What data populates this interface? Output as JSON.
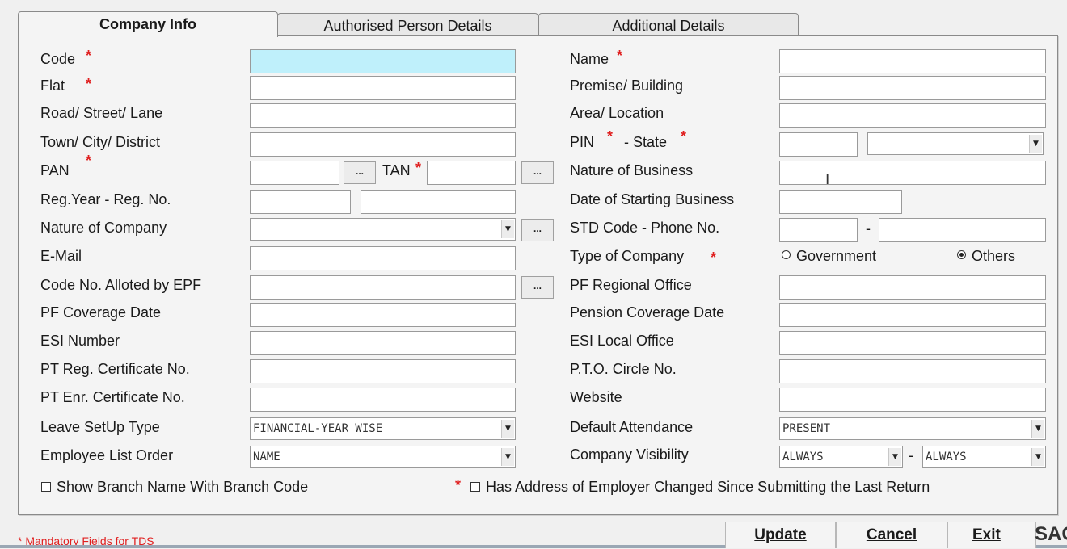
{
  "tabs": [
    {
      "label": "Company Info",
      "active": true
    },
    {
      "label": "Authorised Person Details",
      "active": false
    },
    {
      "label": "Additional Details",
      "active": false
    }
  ],
  "mandatory_mark": "*",
  "ellipsis": "...",
  "left": {
    "code": "Code",
    "flat": "Flat",
    "road": "Road/ Street/ Lane",
    "town": "Town/ City/ District",
    "pan": "PAN",
    "tan": "TAN",
    "reg": "Reg.Year - Reg. No.",
    "nature_company": "Nature of Company",
    "email": "E-Mail",
    "epf_code": "Code No. Alloted by EPF",
    "pf_coverage": "PF Coverage Date",
    "esi_number": "ESI Number",
    "pt_reg": "PT Reg. Certificate No.",
    "pt_enr": "PT Enr. Certificate No.",
    "leave_setup": "Leave SetUp Type",
    "leave_setup_value": "FINANCIAL-YEAR WISE",
    "employee_order": "Employee List Order",
    "employee_order_value": "NAME"
  },
  "right": {
    "name": "Name",
    "premise": "Premise/ Building",
    "area": "Area/ Location",
    "pin": "PIN",
    "state": "- State",
    "nature_business": "Nature of Business",
    "date_start": "Date of Starting Business",
    "std_phone": "STD Code - Phone No.",
    "phone_sep": "-",
    "type_company": "Type of Company",
    "radio_government": "Government",
    "radio_others": "Others",
    "selected_type": "Others",
    "pf_regional": "PF Regional Office",
    "pension_coverage": "Pension Coverage Date",
    "esi_local": "ESI Local Office",
    "pto_circle": "P.T.O. Circle No.",
    "website": "Website",
    "default_attendance": "Default Attendance",
    "default_attendance_value": "PRESENT",
    "visibility": "Company Visibility",
    "visibility_from": "ALWAYS",
    "visibility_sep": "-",
    "visibility_to": "ALWAYS"
  },
  "checkboxes": {
    "branch_name": "Show Branch Name With Branch Code",
    "address_changed": "Has Address of Employer Changed Since Submitting the Last Return"
  },
  "footer": {
    "note": "Mandatory Fields for TDS",
    "update": "Update",
    "cancel": "Cancel",
    "exit": "Exit",
    "brand": "SAG"
  },
  "colors": {
    "mandatory": "#e02020",
    "highlight_field": "#bff0fb"
  }
}
